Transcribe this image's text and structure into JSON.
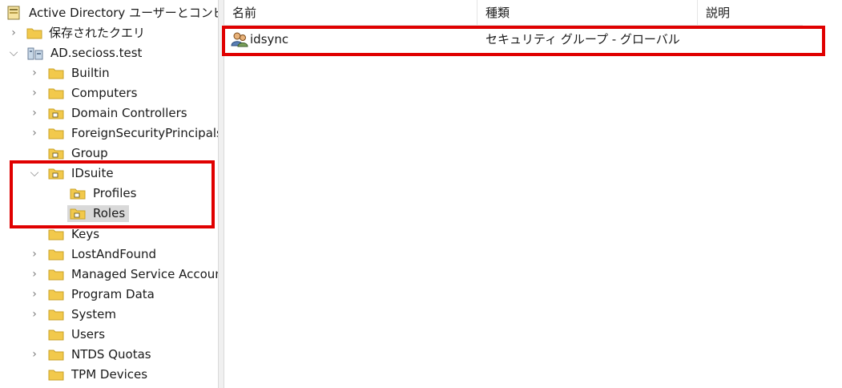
{
  "tree": {
    "root_label": "Active Directory ユーザーとコンピュー",
    "saved_queries_label": "保存されたクエリ",
    "domain_label": "AD.secioss.test",
    "items": [
      {
        "label": "Builtin"
      },
      {
        "label": "Computers"
      },
      {
        "label": "Domain Controllers"
      },
      {
        "label": "ForeignSecurityPrincipals"
      },
      {
        "label": "Group"
      },
      {
        "label": "IDsuite",
        "children": [
          {
            "label": "Profiles"
          },
          {
            "label": "Roles",
            "selected": true
          }
        ]
      },
      {
        "label": "Keys"
      },
      {
        "label": "LostAndFound"
      },
      {
        "label": "Managed Service Accounts"
      },
      {
        "label": "Program Data"
      },
      {
        "label": "System"
      },
      {
        "label": "Users"
      },
      {
        "label": "NTDS Quotas"
      },
      {
        "label": "TPM Devices"
      }
    ]
  },
  "list": {
    "columns": {
      "name": "名前",
      "type": "種類",
      "description": "説明"
    },
    "rows": [
      {
        "name": "idsync",
        "type": "セキュリティ グループ - グローバル",
        "description": ""
      }
    ]
  },
  "colors": {
    "highlight": "#e00000",
    "folder": "#f2c94c",
    "selection": "#d9d9d9"
  }
}
